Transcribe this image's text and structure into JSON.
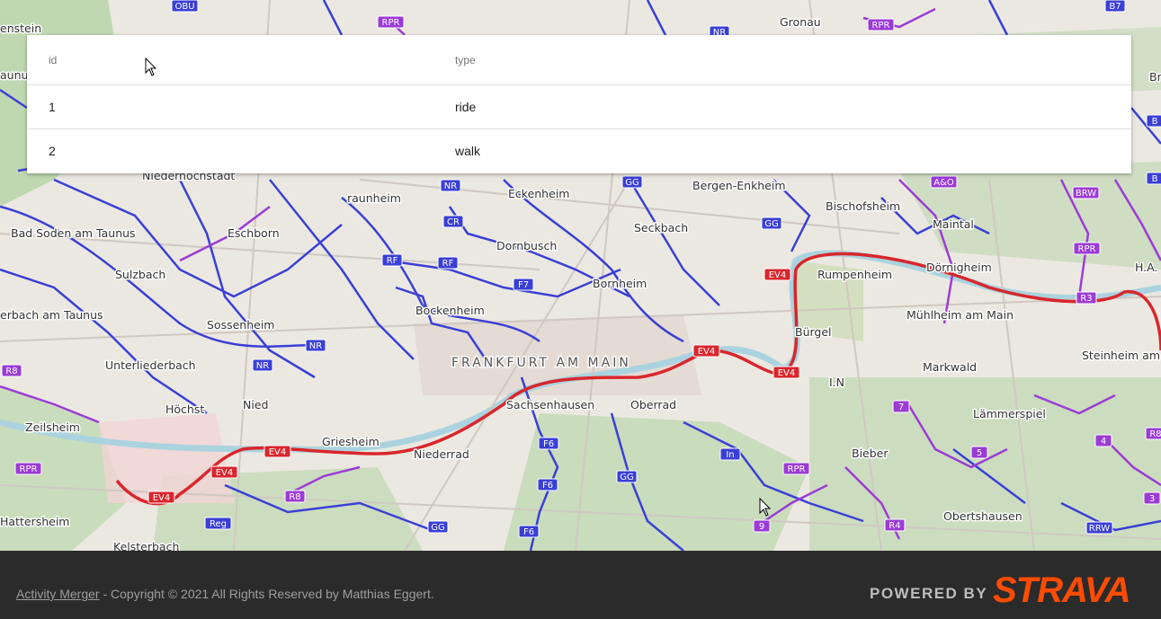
{
  "map": {
    "city_label": "FRANKFURT AM MAIN",
    "places": [
      {
        "name": "Niederhochstadt"
      },
      {
        "name": "raunheim"
      },
      {
        "name": "Eckenheim"
      },
      {
        "name": "Bergen-Enkheim"
      },
      {
        "name": "Bischofsheim"
      },
      {
        "name": "Maintal"
      },
      {
        "name": "Bad Soden am Taunus"
      },
      {
        "name": "Eschborn"
      },
      {
        "name": "Seckbach"
      },
      {
        "name": "Dornbusch"
      },
      {
        "name": "Sulzbach"
      },
      {
        "name": "Rumpenheim"
      },
      {
        "name": "Dörnigheim"
      },
      {
        "name": "Bornheim"
      },
      {
        "name": "Bockenheim"
      },
      {
        "name": "Mühlheim am Main"
      },
      {
        "name": "erbach am Taunus"
      },
      {
        "name": "Sossenheim"
      },
      {
        "name": "Bürgel"
      },
      {
        "name": "Unterliederbach"
      },
      {
        "name": "Markwald"
      },
      {
        "name": "Steinheim am"
      },
      {
        "name": "Sachsenhausen"
      },
      {
        "name": "Oberrad"
      },
      {
        "name": "Höchst"
      },
      {
        "name": "Nied"
      },
      {
        "name": "Lämmerspiel"
      },
      {
        "name": "Zeilsheim"
      },
      {
        "name": "Griesheim"
      },
      {
        "name": "Niederrad"
      },
      {
        "name": "Bieber"
      },
      {
        "name": "Obertshausen"
      },
      {
        "name": "Hattersheim"
      },
      {
        "name": "Kelsterbach"
      },
      {
        "name": "enstein"
      },
      {
        "name": "aunus"
      },
      {
        "name": "Gronau"
      },
      {
        "name": "H.A."
      },
      {
        "name": "I.N"
      },
      {
        "name": "Br"
      }
    ],
    "route_badges": [
      {
        "label": "OBU",
        "color": "#3a3fd6"
      },
      {
        "label": "RPR",
        "color": "#9b3bd6"
      },
      {
        "label": "NR",
        "color": "#3a3fd6"
      },
      {
        "label": "RPR",
        "color": "#9b3bd6"
      },
      {
        "label": "B7",
        "color": "#3a3fd6"
      },
      {
        "label": "NR",
        "color": "#3a3fd6"
      },
      {
        "label": "GG",
        "color": "#3a3fd6"
      },
      {
        "label": "A&O",
        "color": "#9b3bd6"
      },
      {
        "label": "BRW",
        "color": "#9b3bd6"
      },
      {
        "label": "CR",
        "color": "#3a3fd6"
      },
      {
        "label": "GG",
        "color": "#3a3fd6"
      },
      {
        "label": "RF",
        "color": "#3a3fd6"
      },
      {
        "label": "RF",
        "color": "#3a3fd6"
      },
      {
        "label": "RPR",
        "color": "#9b3bd6"
      },
      {
        "label": "EV4",
        "color": "#d9262c"
      },
      {
        "label": "F7",
        "color": "#3a3fd6"
      },
      {
        "label": "R3",
        "color": "#9b3bd6"
      },
      {
        "label": "NR",
        "color": "#3a3fd6"
      },
      {
        "label": "R8",
        "color": "#9b3bd6"
      },
      {
        "label": "NR",
        "color": "#3a3fd6"
      },
      {
        "label": "EV4",
        "color": "#d9262c"
      },
      {
        "label": "EV4",
        "color": "#d9262c"
      },
      {
        "label": "7",
        "color": "#9b3bd6"
      },
      {
        "label": "F6",
        "color": "#3a3fd6"
      },
      {
        "label": "4",
        "color": "#9b3bd6"
      },
      {
        "label": "EV4",
        "color": "#d9262c"
      },
      {
        "label": "In",
        "color": "#3a3fd6"
      },
      {
        "label": "5",
        "color": "#9b3bd6"
      },
      {
        "label": "RPR",
        "color": "#9b3bd6"
      },
      {
        "label": "EV4",
        "color": "#d9262c"
      },
      {
        "label": "GG",
        "color": "#3a3fd6"
      },
      {
        "label": "F6",
        "color": "#3a3fd6"
      },
      {
        "label": "EV4",
        "color": "#d9262c"
      },
      {
        "label": "R8",
        "color": "#9b3bd6"
      },
      {
        "label": "3",
        "color": "#9b3bd6"
      },
      {
        "label": "Reg",
        "color": "#3a3fd6"
      },
      {
        "label": "GG",
        "color": "#3a3fd6"
      },
      {
        "label": "9",
        "color": "#9b3bd6"
      },
      {
        "label": "R4",
        "color": "#9b3bd6"
      },
      {
        "label": "RRW",
        "color": "#3a3fd6"
      },
      {
        "label": "F6",
        "color": "#3a3fd6"
      },
      {
        "label": "B",
        "color": "#3a3fd6"
      },
      {
        "label": "B",
        "color": "#3a3fd6"
      },
      {
        "label": "R8",
        "color": "#9b3bd6"
      },
      {
        "label": "RPR",
        "color": "#9b3bd6"
      }
    ],
    "colors": {
      "river": "#aad3df",
      "ev4_route": "#d9262c",
      "regional_route": "#3a3fd6",
      "local_route": "#9b3bd6",
      "forest": "#add19e"
    }
  },
  "table": {
    "headers": {
      "id": "id",
      "type": "type"
    },
    "rows": [
      {
        "id": "1",
        "type": "ride"
      },
      {
        "id": "2",
        "type": "walk"
      }
    ]
  },
  "footer": {
    "link_text": "Activity Merger",
    "copyright": " - Copyright © 2021 All Rights Reserved by Matthias Eggert.",
    "powered_by": "POWERED BY",
    "strava_logo": "STRAVA",
    "strava_color": "#fc4c02"
  }
}
